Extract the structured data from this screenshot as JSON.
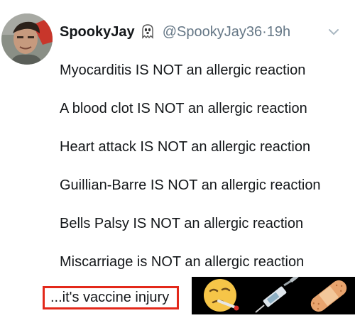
{
  "tweet": {
    "display_name": "SpookyJay",
    "handle": "@SpookyJay36",
    "separator": "·",
    "time": "19h",
    "icons": {
      "name_emoji": "ghost-icon",
      "menu": "chevron-down-icon"
    },
    "lines": [
      "Myocarditis IS NOT an allergic reaction",
      "A blood clot IS NOT an allergic reaction",
      "Heart attack IS NOT an allergic reaction",
      "Guillian-Barre IS NOT an allergic reaction",
      "Bells Palsy IS NOT an allergic reaction",
      "Miscarriage is NOT an allergic reaction"
    ]
  },
  "overlay": {
    "highlight_text": "...it's vaccine injury",
    "highlight_color": "#e3281a",
    "emojis": [
      "sick-face-thermometer-icon",
      "syringe-icon",
      "bandage-icon"
    ]
  }
}
